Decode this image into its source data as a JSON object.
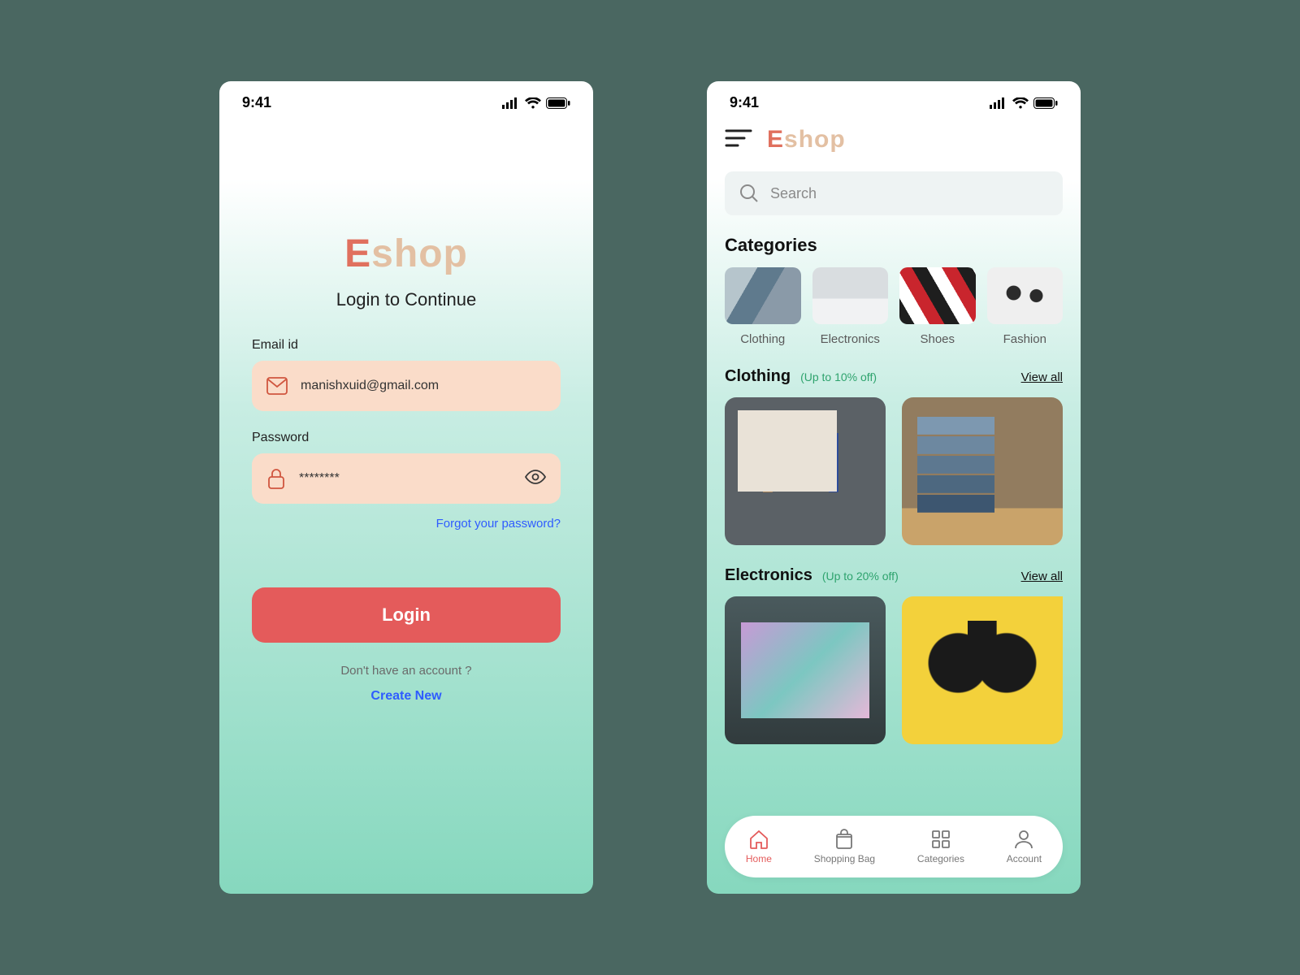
{
  "status": {
    "time": "9:41"
  },
  "brand": {
    "E": "E",
    "shop": "shop"
  },
  "login": {
    "tagline": "Login to Continue",
    "email_label": "Email id",
    "email_value": "manishxuid@gmail.com",
    "password_label": "Password",
    "password_value": "********",
    "forgot": "Forgot your password?",
    "button": "Login",
    "no_account": "Don't have an account ?",
    "create": "Create New"
  },
  "home": {
    "search_placeholder": "Search",
    "categories_title": "Categories",
    "categories": [
      {
        "label": "Clothing"
      },
      {
        "label": "Electronics"
      },
      {
        "label": "Shoes"
      },
      {
        "label": "Fashion"
      }
    ],
    "sections": [
      {
        "name": "Clothing",
        "deal": "(Up to 10% off)",
        "viewall": "View all"
      },
      {
        "name": "Electronics",
        "deal": "(Up to 20% off)",
        "viewall": "View all"
      }
    ],
    "tabs": [
      {
        "label": "Home"
      },
      {
        "label": "Shopping Bag"
      },
      {
        "label": "Categories"
      },
      {
        "label": "Account"
      }
    ]
  },
  "colors": {
    "accent": "#e45b5b",
    "link": "#2f5cff",
    "deal": "#2ea36d"
  }
}
